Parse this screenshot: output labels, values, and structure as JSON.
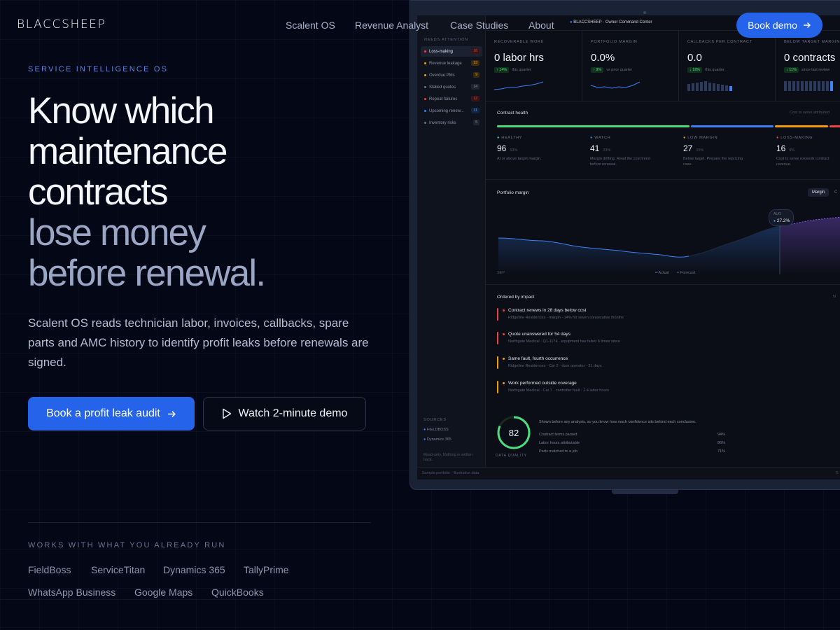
{
  "brand": "BLACCSHEEP",
  "nav": [
    "Scalent OS",
    "Revenue Analyst",
    "Case Studies",
    "About"
  ],
  "nav_button": "Book demo",
  "hero": {
    "eyebrow": "SERVICE INTELLIGENCE OS",
    "title_white": [
      "Know which",
      "maintenance",
      "contracts"
    ],
    "title_muted": [
      "lose money",
      "before renewal."
    ],
    "lede": "Scalent OS reads technician labor, invoices, callbacks, spare parts and AMC history to identify profit leaks before renewals are signed.",
    "primary_cta": "Book a profit leak audit",
    "secondary_cta": "Watch 2-minute demo"
  },
  "works_with": {
    "label": "WORKS WITH WHAT YOU ALREADY RUN",
    "tools": [
      "FieldBoss",
      "ServiceTitan",
      "Dynamics 365",
      "TallyPrime",
      "WhatsApp Business",
      "Google Maps",
      "QuickBooks"
    ]
  },
  "dashboard": {
    "window_title": "BLACCSHEEP · Owner Command Center",
    "sidebar_heading": "NEEDS ATTENTION",
    "sidebar": [
      {
        "label": "Loss-making",
        "count": "16",
        "color": "#ef4444"
      },
      {
        "label": "Revenue leakage",
        "count": "23",
        "color": "#f59e0b"
      },
      {
        "label": "Overdue PMs",
        "count": "9",
        "color": "#f59e0b"
      },
      {
        "label": "Stalled quotes",
        "count": "14",
        "color": "#6b7280"
      },
      {
        "label": "Repeat failures",
        "count": "12",
        "color": "#ef4444"
      },
      {
        "label": "Upcoming renew...",
        "count": "31",
        "color": "#3b82f6"
      },
      {
        "label": "Inventory risks",
        "count": "5",
        "color": "#6b7280"
      }
    ],
    "sources_heading": "SOURCES",
    "sources": [
      "FIELDBOSS",
      "Dynamics 365"
    ],
    "sources_note": "Read-only. Nothing is written back.",
    "kpis": [
      {
        "label": "RECOVERABLE WORK",
        "value": "0 labor hrs",
        "delta": "14%",
        "note": "this quarter"
      },
      {
        "label": "PORTFOLIO MARGIN",
        "value": "0.0%",
        "delta": "9%",
        "note": "vs prior quarter"
      },
      {
        "label": "CALLBACKS PER CONTRACT",
        "value": "0.0",
        "delta": "18%",
        "note": "this quarter"
      },
      {
        "label": "BELOW TARGET MARGIN",
        "value": "0 contracts",
        "delta": "11%",
        "note": "since last review"
      }
    ],
    "health": {
      "title": "Contract health",
      "aside": "Cost to serve attributed",
      "segments": [
        {
          "label": "HEALTHY",
          "count": "96",
          "pct": "53%",
          "desc": "At or above target margin.",
          "color": "#4ade80"
        },
        {
          "label": "WATCH",
          "count": "41",
          "pct": "23%",
          "desc": "Margin drifting. Read the cost trend before renewal.",
          "color": "#3b82f6"
        },
        {
          "label": "LOW MARGIN",
          "count": "27",
          "pct": "15%",
          "desc": "Below target. Prepare the repricing case.",
          "color": "#f59e0b"
        },
        {
          "label": "LOSS-MAKING",
          "count": "16",
          "pct": "9%",
          "desc": "Cost to serve exceeds contract revenue.",
          "color": "#ef4444"
        }
      ]
    },
    "margin_chart": {
      "title": "Portfolio margin",
      "tabs": [
        "Margin",
        "C"
      ],
      "start_label": "SEP",
      "tooltip_month": "AUG",
      "tooltip_value": "27.2%",
      "legend": [
        "Actual",
        "Forecast"
      ]
    },
    "impact": {
      "title": "Ordered by impact",
      "aside": "N",
      "items": [
        {
          "title": "Contract renews in 28 days below cost",
          "detail": "Ridgeline Residences · margin −14% for seven consecutive months",
          "color": "#ef4444"
        },
        {
          "title": "Quote unanswered for 54 days",
          "detail": "Northgate Medical · Q1-1174 · equipment has failed 6 times since",
          "color": "#ef4444"
        },
        {
          "title": "Same fault, fourth occurrence",
          "detail": "Ridgeline Residences · Car 2 · door operator · 31 days",
          "color": "#f59e0b"
        },
        {
          "title": "Work performed outside coverage",
          "detail": "Northgate Medical · Car 7 · controller fault · 2.4 labor hours",
          "color": "#f59e0b"
        }
      ]
    },
    "data_quality": {
      "score": "82",
      "label": "DATA QUALITY",
      "intro": "Shown before any analysis, so you know how much confidence sits behind each conclusion.",
      "rows": [
        {
          "label": "Contract terms parsed",
          "value": "94%"
        },
        {
          "label": "Labor hours attributable",
          "value": "86%"
        },
        {
          "label": "Parts matched to a job",
          "value": "71%"
        }
      ]
    },
    "footer": "Sample portfolio · illustrative data",
    "footer_right": "S"
  },
  "colors": {
    "accent": "#2563eb",
    "background": "#040816",
    "healthy": "#4ade80",
    "watch": "#3b82f6",
    "low": "#f59e0b",
    "loss": "#ef4444"
  }
}
